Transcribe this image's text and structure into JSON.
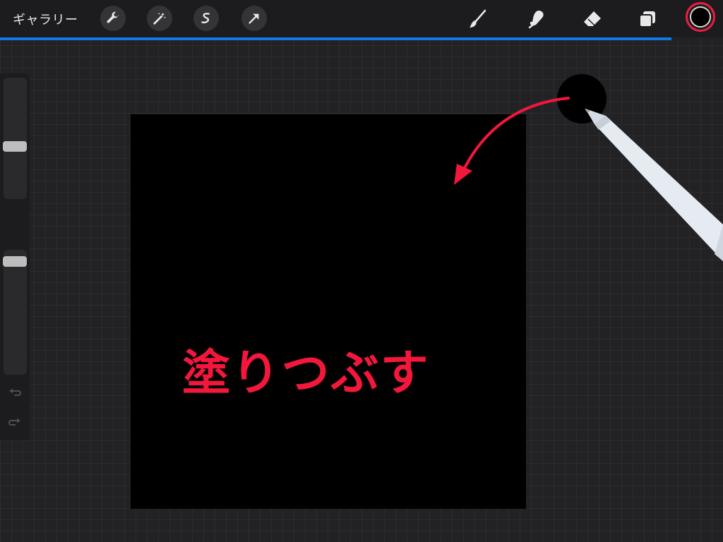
{
  "toolbar": {
    "gallery_label": "ギャラリー",
    "actions": [
      "wrench-icon",
      "magic-wand-icon",
      "selection-icon",
      "transform-arrow-icon"
    ],
    "tools": [
      "brush-icon",
      "smudge-icon",
      "eraser-icon",
      "layers-icon"
    ],
    "active_color": "#000000",
    "highlight_color": "#ef1d3e",
    "progress_color": "#1476e6"
  },
  "sidebar": {
    "size_slider_value": 0.6,
    "opacity_slider_value": 0.9,
    "buttons": [
      "modify-square-icon",
      "undo-icon",
      "redo-icon"
    ]
  },
  "canvas": {
    "fill_color": "#000000",
    "annotation_text": "塗りつぶす",
    "annotation_color": "#f2173b"
  }
}
